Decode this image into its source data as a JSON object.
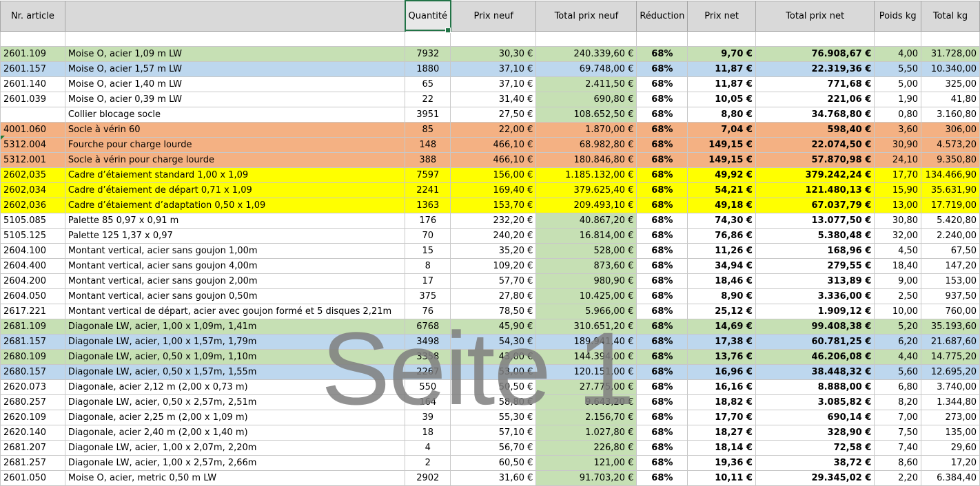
{
  "headers": [
    "Nr. article",
    "",
    "Quantité",
    "Prix neuf",
    "Total prix neuf",
    "Réduction",
    "Prix net",
    "Total prix net",
    "Poids kg",
    "Total kg"
  ],
  "colors": {
    "green": "#c6e0b4",
    "blue": "#bdd7ee",
    "orange": "#f4b183",
    "yellow": "#ffff00",
    "white": "#ffffff"
  },
  "rows": [
    {
      "nr": "2601.109",
      "desc": "Moise O, acier 1,09 m LW",
      "qty": "7932",
      "prix": "30,30 €",
      "total": "240.339,60 €",
      "red": "68%",
      "net": "9,70 €",
      "tnet": "76.908,67 €",
      "poids": "4,00",
      "tkg": "31.728,00",
      "bg": "green"
    },
    {
      "nr": "2601.157",
      "desc": "Moise O, acier 1,57 m LW",
      "qty": "1880",
      "prix": "37,10 €",
      "total": "69.748,00 €",
      "red": "68%",
      "net": "11,87 €",
      "tnet": "22.319,36 €",
      "poids": "5,50",
      "tkg": "10.340,00",
      "bg": "blue"
    },
    {
      "nr": "2601.140",
      "desc": "Moise O, acier 1,40 m LW",
      "qty": "65",
      "prix": "37,10 €",
      "total": "2.411,50 €",
      "red": "68%",
      "net": "11,87 €",
      "tnet": "771,68 €",
      "poids": "5,00",
      "tkg": "325,00",
      "bg": "white"
    },
    {
      "nr": "2601.039",
      "desc": "Moise O, acier 0,39 m LW",
      "qty": "22",
      "prix": "31,40 €",
      "total": "690,80 €",
      "red": "68%",
      "net": "10,05 €",
      "tnet": "221,06 €",
      "poids": "1,90",
      "tkg": "41,80",
      "bg": "white"
    },
    {
      "nr": "",
      "desc": "Collier blocage socle",
      "qty": "3951",
      "prix": "27,50 €",
      "total": "108.652,50 €",
      "red": "68%",
      "net": "8,80 €",
      "tnet": "34.768,80 €",
      "poids": "0,80",
      "tkg": "3.160,80",
      "bg": "white"
    },
    {
      "nr": "4001.060",
      "desc": "Socle à vérin 60",
      "qty": "85",
      "prix": "22,00 €",
      "total": "1.870,00 €",
      "red": "68%",
      "net": "7,04 €",
      "tnet": "598,40 €",
      "poids": "3,60",
      "tkg": "306,00",
      "bg": "orange"
    },
    {
      "nr": "5312.004",
      "desc": "Fourche pour charge lourde",
      "qty": "148",
      "prix": "466,10 €",
      "total": "68.982,80 €",
      "red": "68%",
      "net": "149,15 €",
      "tnet": "22.074,50 €",
      "poids": "30,90",
      "tkg": "4.573,20",
      "bg": "orange"
    },
    {
      "nr": "5312.001",
      "desc": "Socle à vérin pour charge lourde",
      "qty": "388",
      "prix": "466,10 €",
      "total": "180.846,80 €",
      "red": "68%",
      "net": "149,15 €",
      "tnet": "57.870,98 €",
      "poids": "24,10",
      "tkg": "9.350,80",
      "bg": "orange"
    },
    {
      "nr": "2602,035",
      "desc": "Cadre d’étaiement standard  1,00 x 1,09",
      "qty": "7597",
      "prix": "156,00 €",
      "total": "1.185.132,00 €",
      "red": "68%",
      "net": "49,92 €",
      "tnet": "379.242,24 €",
      "poids": "17,70",
      "tkg": "134.466,90",
      "bg": "yellow"
    },
    {
      "nr": "2602,034",
      "desc": "Cadre d’étaiement de départ  0,71 x 1,09",
      "qty": "2241",
      "prix": "169,40 €",
      "total": "379.625,40 €",
      "red": "68%",
      "net": "54,21 €",
      "tnet": "121.480,13 €",
      "poids": "15,90",
      "tkg": "35.631,90",
      "bg": "yellow"
    },
    {
      "nr": "2602,036",
      "desc": "Cadre d’étaiement d’adaptation 0,50 x 1,09",
      "qty": "1363",
      "prix": "153,70 €",
      "total": "209.493,10 €",
      "red": "68%",
      "net": "49,18 €",
      "tnet": "67.037,79 €",
      "poids": "13,00",
      "tkg": "17.719,00",
      "bg": "yellow"
    },
    {
      "nr": "5105.085",
      "desc": "Palette 85 0,97 x 0,91 m",
      "qty": "176",
      "prix": "232,20 €",
      "total": "40.867,20 €",
      "red": "68%",
      "net": "74,30 €",
      "tnet": "13.077,50 €",
      "poids": "30,80",
      "tkg": "5.420,80",
      "bg": "white"
    },
    {
      "nr": "5105.125",
      "desc": "Palette 125 1,37 x 0,97",
      "qty": "70",
      "prix": "240,20 €",
      "total": "16.814,00 €",
      "red": "68%",
      "net": "76,86 €",
      "tnet": "5.380,48 €",
      "poids": "32,00",
      "tkg": "2.240,00",
      "bg": "white"
    },
    {
      "nr": "2604.100",
      "desc": "Montant vertical, acier sans goujon 1,00m",
      "qty": "15",
      "prix": "35,20 €",
      "total": "528,00 €",
      "red": "68%",
      "net": "11,26 €",
      "tnet": "168,96 €",
      "poids": "4,50",
      "tkg": "67,50",
      "bg": "white"
    },
    {
      "nr": "2604.400",
      "desc": "Montant vertical, acier sans goujon 4,00m",
      "qty": "8",
      "prix": "109,20 €",
      "total": "873,60 €",
      "red": "68%",
      "net": "34,94 €",
      "tnet": "279,55 €",
      "poids": "18,40",
      "tkg": "147,20",
      "bg": "white"
    },
    {
      "nr": "2604.200",
      "desc": "Montant vertical, acier sans goujon 2,00m",
      "qty": "17",
      "prix": "57,70 €",
      "total": "980,90 €",
      "red": "68%",
      "net": "18,46 €",
      "tnet": "313,89 €",
      "poids": "9,00",
      "tkg": "153,00",
      "bg": "white"
    },
    {
      "nr": "2604.050",
      "desc": "Montant vertical, acier sans goujon 0,50m",
      "qty": "375",
      "prix": "27,80 €",
      "total": "10.425,00 €",
      "red": "68%",
      "net": "8,90 €",
      "tnet": "3.336,00 €",
      "poids": "2,50",
      "tkg": "937,50",
      "bg": "white"
    },
    {
      "nr": "2617.221",
      "desc": "Montant vertical de départ, acier avec goujon formé et 5 disques 2,21m",
      "qty": "76",
      "prix": "78,50 €",
      "total": "5.966,00 €",
      "red": "68%",
      "net": "25,12 €",
      "tnet": "1.909,12 €",
      "poids": "10,00",
      "tkg": "760,00",
      "bg": "white"
    },
    {
      "nr": "2681.109",
      "desc": "Diagonale LW, acier, 1,00 x 1,09m, 1,41m",
      "qty": "6768",
      "prix": "45,90 €",
      "total": "310.651,20 €",
      "red": "68%",
      "net": "14,69 €",
      "tnet": "99.408,38 €",
      "poids": "5,20",
      "tkg": "35.193,60",
      "bg": "green"
    },
    {
      "nr": "2681.157",
      "desc": "Diagonale LW, acier, 1,00 x 1,57m, 1,79m",
      "qty": "3498",
      "prix": "54,30 €",
      "total": "189.941,40 €",
      "red": "68%",
      "net": "17,38 €",
      "tnet": "60.781,25 €",
      "poids": "6,20",
      "tkg": "21.687,60",
      "bg": "blue"
    },
    {
      "nr": "2680.109",
      "desc": "Diagonale LW, acier, 0,50 x 1,09m, 1,10m",
      "qty": "3358",
      "prix": "43,00 €",
      "total": "144.394,00 €",
      "red": "68%",
      "net": "13,76 €",
      "tnet": "46.206,08 €",
      "poids": "4,40",
      "tkg": "14.775,20",
      "bg": "green"
    },
    {
      "nr": "2680.157",
      "desc": "Diagonale LW, acier, 0,50 x 1,57m, 1,55m",
      "qty": "2267",
      "prix": "53,00 €",
      "total": "120.151,00 €",
      "red": "68%",
      "net": "16,96 €",
      "tnet": "38.448,32 €",
      "poids": "5,60",
      "tkg": "12.695,20",
      "bg": "blue"
    },
    {
      "nr": "2620.073",
      "desc": "Diagonale, acier 2,12 m (2,00 x  0,73 m)",
      "qty": "550",
      "prix": "50,50 €",
      "total": "27.775,00 €",
      "red": "68%",
      "net": "16,16 €",
      "tnet": "8.888,00 €",
      "poids": "6,80",
      "tkg": "3.740,00",
      "bg": "white"
    },
    {
      "nr": "2680.257",
      "desc": "Diagonale LW, acier, 0,50 x 2,57m, 2,51m",
      "qty": "164",
      "prix": "58,80 €",
      "total": "9.643,20 €",
      "red": "68%",
      "net": "18,82 €",
      "tnet": "3.085,82 €",
      "poids": "8,20",
      "tkg": "1.344,80",
      "bg": "white"
    },
    {
      "nr": "2620.109",
      "desc": "Diagonale, acier 2,25 m (2,00 x 1,09 m)",
      "qty": "39",
      "prix": "55,30 €",
      "total": "2.156,70 €",
      "red": "68%",
      "net": "17,70 €",
      "tnet": "690,14 €",
      "poids": "7,00",
      "tkg": "273,00",
      "bg": "white"
    },
    {
      "nr": "2620.140",
      "desc": "Diagonale, acier 2,40 m (2,00 x 1,40 m)",
      "qty": "18",
      "prix": "57,10 €",
      "total": "1.027,80 €",
      "red": "68%",
      "net": "18,27 €",
      "tnet": "328,90 €",
      "poids": "7,50",
      "tkg": "135,00",
      "bg": "white"
    },
    {
      "nr": "2681.207",
      "desc": "Diagonale LW, acier, 1,00 x 2,07m, 2,20m",
      "qty": "4",
      "prix": "56,70 €",
      "total": "226,80 €",
      "red": "68%",
      "net": "18,14 €",
      "tnet": "72,58 €",
      "poids": "7,40",
      "tkg": "29,60",
      "bg": "white"
    },
    {
      "nr": "2681.257",
      "desc": "Diagonale LW, acier, 1,00 x 2,57m, 2,66m",
      "qty": "2",
      "prix": "60,50 €",
      "total": "121,00 €",
      "red": "68%",
      "net": "19,36 €",
      "tnet": "38,72 €",
      "poids": "8,60",
      "tkg": "17,20",
      "bg": "white"
    },
    {
      "nr": "2601.050",
      "desc": "Moise O, acier, metric 0,50 m LW",
      "qty": "2902",
      "prix": "31,60 €",
      "total": "91.703,20 €",
      "red": "68%",
      "net": "10,11 €",
      "tnet": "29.345,02 €",
      "poids": "2,20",
      "tkg": "6.384,40",
      "bg": "white"
    }
  ],
  "watermark": "Seite 1"
}
